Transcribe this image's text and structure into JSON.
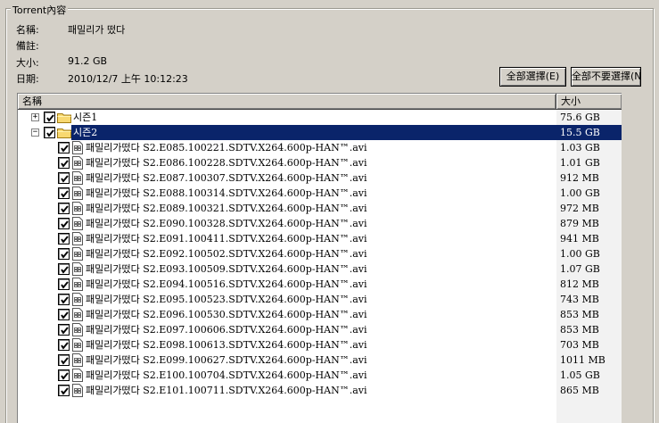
{
  "group_title": "Torrent內容",
  "info": {
    "name_label": "名稱:",
    "name_value": "패밀리가 떴다",
    "comment_label": "備註:",
    "comment_value": "",
    "size_label": "大小:",
    "size_value": "91.2 GB",
    "date_label": "日期:",
    "date_value": "2010/12/7 上午 10:12:23"
  },
  "buttons": {
    "select_all": "全部選擇(E)",
    "select_none": "全部不要選擇(N)"
  },
  "columns": {
    "name": "名稱",
    "size": "大小"
  },
  "tree": [
    {
      "type": "folder",
      "name": "시즌1",
      "size": "75.6 GB",
      "expanded": false,
      "checked": true,
      "selected": false
    },
    {
      "type": "folder",
      "name": "시즌2",
      "size": "15.5 GB",
      "expanded": true,
      "checked": true,
      "selected": true
    }
  ],
  "files": [
    {
      "name": "패밀리가떴다 S2.E085.100221.SDTV.X264.600p-HAN™.avi",
      "size": "1.03 GB"
    },
    {
      "name": "패밀리가떴다 S2.E086.100228.SDTV.X264.600p-HAN™.avi",
      "size": "1.01 GB"
    },
    {
      "name": "패밀리가떴다 S2.E087.100307.SDTV.X264.600p-HAN™.avi",
      "size": "912 MB"
    },
    {
      "name": "패밀리가떴다 S2.E088.100314.SDTV.X264.600p-HAN™.avi",
      "size": "1.00 GB"
    },
    {
      "name": "패밀리가떴다 S2.E089.100321.SDTV.X264.600p-HAN™.avi",
      "size": "972 MB"
    },
    {
      "name": "패밀리가떴다 S2.E090.100328.SDTV.X264.600p-HAN™.avi",
      "size": "879 MB"
    },
    {
      "name": "패밀리가떴다 S2.E091.100411.SDTV.X264.600p-HAN™.avi",
      "size": "941 MB"
    },
    {
      "name": "패밀리가떴다 S2.E092.100502.SDTV.X264.600p-HAN™.avi",
      "size": "1.00 GB"
    },
    {
      "name": "패밀리가떴다 S2.E093.100509.SDTV.X264.600p-HAN™.avi",
      "size": "1.07 GB"
    },
    {
      "name": "패밀리가떴다 S2.E094.100516.SDTV.X264.600p-HAN™.avi",
      "size": "812 MB"
    },
    {
      "name": "패밀리가떴다 S2.E095.100523.SDTV.X264.600p-HAN™.avi",
      "size": "743 MB"
    },
    {
      "name": "패밀리가떴다 S2.E096.100530.SDTV.X264.600p-HAN™.avi",
      "size": "853 MB"
    },
    {
      "name": "패밀리가떴다 S2.E097.100606.SDTV.X264.600p-HAN™.avi",
      "size": "853 MB"
    },
    {
      "name": "패밀리가떴다 S2.E098.100613.SDTV.X264.600p-HAN™.avi",
      "size": "703 MB"
    },
    {
      "name": "패밀리가떴다 S2.E099.100627.SDTV.X264.600p-HAN™.avi",
      "size": "1011 MB"
    },
    {
      "name": "패밀리가떴다 S2.E100.100704.SDTV.X264.600p-HAN™.avi",
      "size": "1.05 GB"
    },
    {
      "name": "패밀리가떴다 S2.E101.100711.SDTV.X264.600p-HAN™.avi",
      "size": "865 MB"
    }
  ],
  "icons": {
    "folder": "folder-icon",
    "file": "video-file-icon",
    "checkbox": "checkbox-checked-icon"
  },
  "colors": {
    "selection": "#0a246a",
    "folder": "#f8d870",
    "window_bg": "#d4d0c8"
  }
}
